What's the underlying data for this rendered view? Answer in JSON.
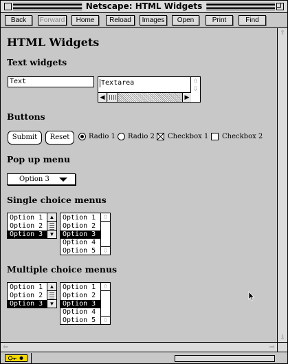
{
  "window": {
    "title": "Netscape: HTML Widgets"
  },
  "toolbar": {
    "buttons": [
      {
        "label": "Back",
        "enabled": true
      },
      {
        "label": "Forward",
        "enabled": false
      },
      {
        "label": "Home",
        "enabled": true
      },
      {
        "label": "Reload",
        "enabled": true
      },
      {
        "label": "Images",
        "enabled": true
      },
      {
        "label": "Open",
        "enabled": true
      },
      {
        "label": "Print",
        "enabled": true
      },
      {
        "label": "Find",
        "enabled": true
      }
    ]
  },
  "page": {
    "heading": "HTML Widgets",
    "sections": {
      "text_widgets": "Text widgets",
      "buttons": "Buttons",
      "popup": "Pop up menu",
      "single": "Single choice menus",
      "multiple": "Multiple choice menus"
    },
    "text_field": {
      "value": "Text"
    },
    "textarea": {
      "value": "Textarea"
    },
    "buttons": {
      "submit": "Submit",
      "reset": "Reset"
    },
    "radios": [
      {
        "label": "Radio 1",
        "checked": true
      },
      {
        "label": "Radio 2",
        "checked": false
      }
    ],
    "checkboxes": [
      {
        "label": "Checkbox 1",
        "checked": true
      },
      {
        "label": "Checkbox 2",
        "checked": false
      }
    ],
    "popup_menu": {
      "selected": "Option 3"
    },
    "single_choice": {
      "list_a": {
        "options": [
          "Option 1",
          "Option 2",
          "Option 3"
        ],
        "selected_index": 2
      },
      "list_b": {
        "options": [
          "Option 1",
          "Option 2",
          "Option 3",
          "Option 4",
          "Option 5"
        ],
        "selected_index": 2
      }
    },
    "multiple_choice": {
      "list_a": {
        "options": [
          "Option 1",
          "Option 2",
          "Option 3"
        ],
        "selected_index": 2
      },
      "list_b": {
        "options": [
          "Option 1",
          "Option 2",
          "Option 3",
          "Option 4",
          "Option 5"
        ],
        "selected_index": 2
      }
    }
  },
  "icons": {
    "close": "close-box-icon",
    "zoom": "zoom-box-icon",
    "scroll_up": "arrow-up-icon",
    "scroll_down": "arrow-down-icon",
    "scroll_left": "arrow-left-icon",
    "scroll_right": "arrow-right-icon",
    "security": "key-icon",
    "cursor": "mouse-pointer-icon"
  },
  "colors": {
    "chrome": "#c8c8c8",
    "field": "#ffffff",
    "status_icon": "#f5d800"
  }
}
